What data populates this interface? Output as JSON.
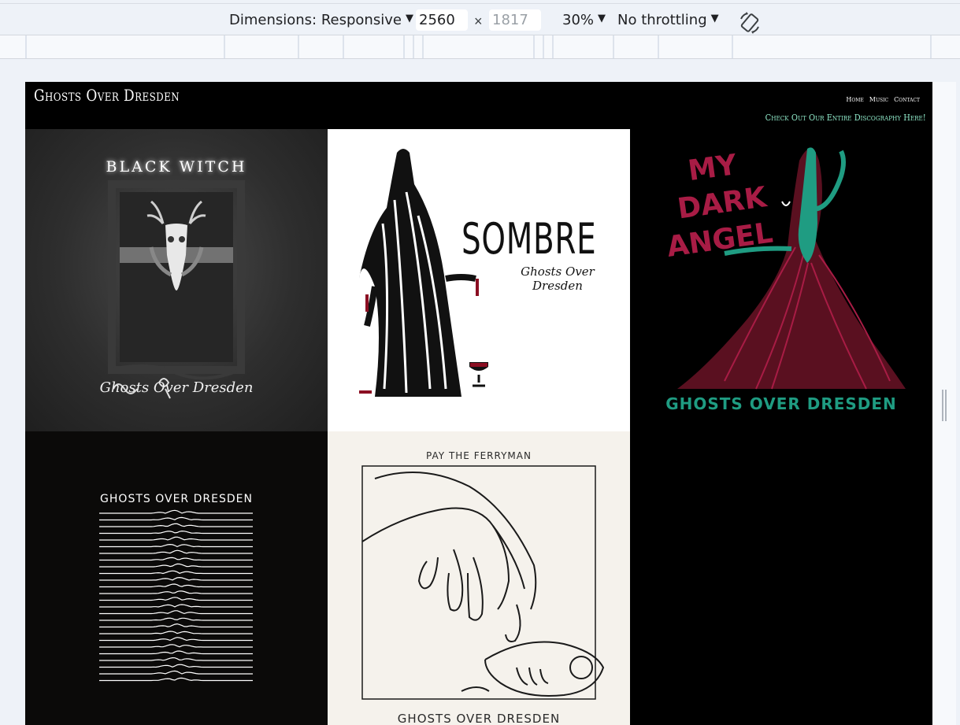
{
  "devtools": {
    "dimensions_label": "Dimensions: Responsive",
    "width_value": "2560",
    "height_placeholder": "1817",
    "times_symbol": "×",
    "zoom": "30%",
    "throttling": "No throttling",
    "caret": "▼"
  },
  "site": {
    "title": "Ghosts Over Dresden",
    "nav": [
      {
        "label": "Home"
      },
      {
        "label": "Music"
      },
      {
        "label": "Contact"
      }
    ],
    "discography_link": "Check Out Our Entire Discography Here!",
    "accent_color": "#8fe8c8"
  },
  "albums": [
    {
      "title": "BLACK WITCH",
      "artist": "Ghosts Over Dresden"
    },
    {
      "title": "SOMBRE",
      "artist": "Ghosts Over Dresden"
    },
    {
      "title_lines": [
        "MY",
        "DARK",
        "ANGEL"
      ],
      "artist": "GHOSTS OVER DRESDEN",
      "title_color": "#a81c45",
      "artist_color": "#1f9c82"
    },
    {
      "artist": "GHOSTS OVER DRESDEN"
    },
    {
      "title": "PAY THE FERRYMAN",
      "artist": "GHOSTS OVER DRESDEN"
    }
  ]
}
